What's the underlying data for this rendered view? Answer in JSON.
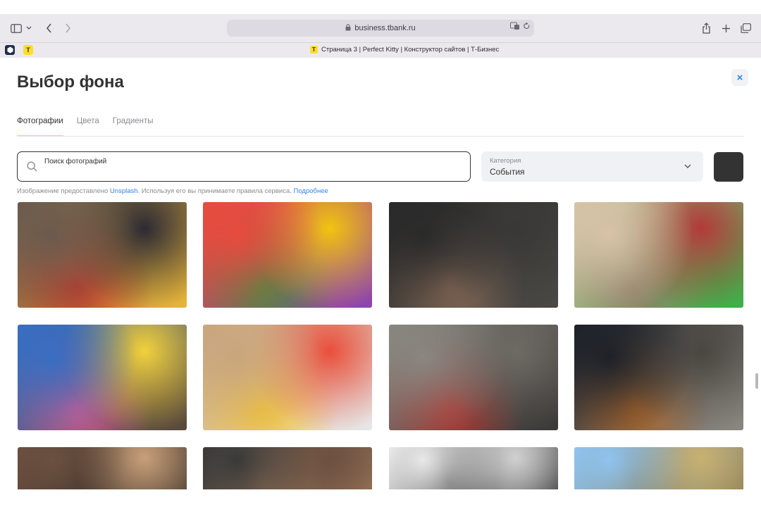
{
  "browser": {
    "url": "business.tbank.ru",
    "tab_title": "Страница 3 | Perfect Kitty | Конструктор сайтов | Т-Бизнес",
    "tab_favicon_letter": "T"
  },
  "modal": {
    "title": "Выбор фона",
    "close_symbol": "×",
    "tabs": [
      {
        "label": "Фотографии",
        "active": true
      },
      {
        "label": "Цвета",
        "active": false
      },
      {
        "label": "Градиенты",
        "active": false
      }
    ],
    "search": {
      "placeholder": "Поиск фотографий"
    },
    "category": {
      "label": "Категория",
      "value": "События"
    },
    "swatch_color": "#333333",
    "attribution": {
      "prefix": "Изображение предоставлено ",
      "source": "Unsplash",
      "middle": ". Используя его вы принимаете правила сервиса. ",
      "more": "Подробнее"
    }
  },
  "photos": [
    {
      "name": "photo-pride-motorcycles",
      "colors": [
        "#6b5a4e",
        "#2c2a33",
        "#c0392b",
        "#e7b43a"
      ]
    },
    {
      "name": "photo-pride-flags-crowd",
      "colors": [
        "#e74c3c",
        "#f1c40f",
        "#3e8e41",
        "#8e44ad"
      ]
    },
    {
      "name": "photo-man-raised-arms",
      "colors": [
        "#2a2a2a",
        "#3a3836",
        "#8d6e5a",
        "#4a4844"
      ]
    },
    {
      "name": "photo-elderly-man-parade",
      "colors": [
        "#d8c2a8",
        "#b33a3a",
        "#8a7660",
        "#3fae49"
      ]
    },
    {
      "name": "photo-ukraine-crowd",
      "colors": [
        "#3a6ec2",
        "#f2d13c",
        "#d85a8a",
        "#5a4a3a"
      ]
    },
    {
      "name": "photo-love-ukraine-sign",
      "colors": [
        "#c9a57c",
        "#e94f3b",
        "#f3c431",
        "#e6e6e6"
      ]
    },
    {
      "name": "photo-we-remember-building",
      "colors": [
        "#8a8680",
        "#6e6a64",
        "#b0342e",
        "#3c3a38"
      ]
    },
    {
      "name": "photo-police-parade",
      "colors": [
        "#1e2128",
        "#4a4640",
        "#b36b2b",
        "#8a8680"
      ]
    },
    {
      "name": "photo-city-street-parade",
      "colors": [
        "#6b5040",
        "#c8a07a",
        "#3a3028"
      ]
    },
    {
      "name": "photo-city-crowd",
      "colors": [
        "#3a3a3a",
        "#6e5040",
        "#a07a5a"
      ]
    },
    {
      "name": "photo-fighter-jets",
      "colors": [
        "#e8e8e8",
        "#d0d0d0",
        "#2a2a2a"
      ]
    },
    {
      "name": "photo-landmark-sky",
      "colors": [
        "#8fc3ef",
        "#c8b070",
        "#8a7a50"
      ]
    }
  ]
}
